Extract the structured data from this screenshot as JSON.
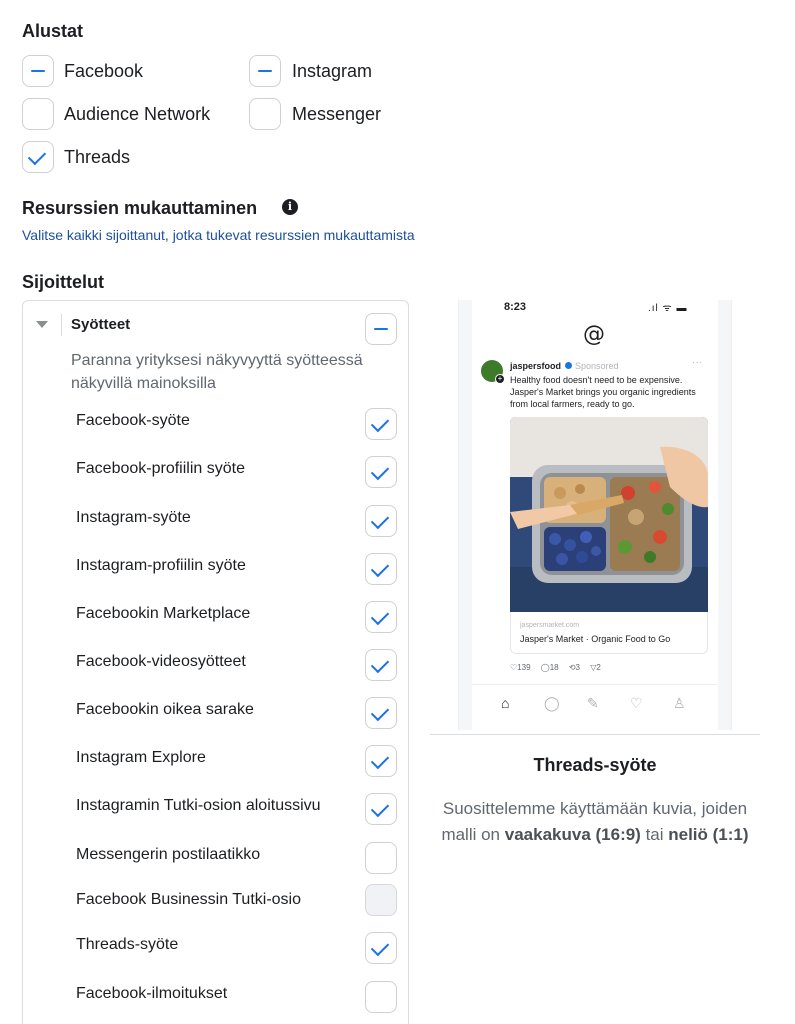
{
  "platforms": {
    "heading": "Alustat",
    "items": [
      {
        "label": "Facebook",
        "state": "partial"
      },
      {
        "label": "Instagram",
        "state": "partial"
      },
      {
        "label": "Audience Network",
        "state": "unchecked"
      },
      {
        "label": "Messenger",
        "state": "unchecked"
      },
      {
        "label": "Threads",
        "state": "checked"
      }
    ]
  },
  "customization": {
    "heading": "Resurssien mukauttaminen",
    "info_icon_glyph": "i",
    "link": "Valitse kaikki sijoittanut, jotka tukevat resurssien mukauttamista"
  },
  "placements": {
    "heading": "Sijoittelut",
    "group": {
      "title": "Syötteet",
      "state": "partial",
      "description": "Paranna yrityksesi näkyvyyttä syötteessä näkyvillä mainoksilla",
      "rows": [
        {
          "label": "Facebook-syöte",
          "state": "checked"
        },
        {
          "label": "Facebook-profiilin syöte",
          "state": "checked"
        },
        {
          "label": "Instagram-syöte",
          "state": "checked"
        },
        {
          "label": "Instagram-profiilin syöte",
          "state": "checked"
        },
        {
          "label": "Facebookin Marketplace",
          "state": "checked"
        },
        {
          "label": "Facebook-videosyötteet",
          "state": "checked"
        },
        {
          "label": "Facebookin oikea sarake",
          "state": "checked"
        },
        {
          "label": "Instagram Explore",
          "state": "checked"
        },
        {
          "label": "Instagramin Tutki-osion aloitussivu",
          "state": "checked"
        },
        {
          "label": "Messengerin postilaatikko",
          "state": "unchecked"
        },
        {
          "label": "Facebook Businessin Tutki-osio",
          "state": "disabled"
        },
        {
          "label": "Threads-syöte",
          "state": "checked"
        },
        {
          "label": "Facebook-ilmoitukset",
          "state": "unchecked"
        }
      ]
    }
  },
  "preview": {
    "phone": {
      "time": "8:23",
      "status_glyphs": ".ıl ᯤ ▬",
      "logo_glyph": "@",
      "username": "jaspersfood",
      "sponsored": "Sponsored",
      "more_glyph": "···",
      "post_text": "Healthy food doesn't need to be expensive. Jasper's Market brings you organic ingredients from local farmers, ready to go.",
      "link_domain": "jaspersmarket.com",
      "link_title": "Jasper's Market · Organic Food to Go",
      "stats": "♡139 ◯18 ⟲3 ▽2",
      "nav_icons": [
        "home-icon",
        "search-icon",
        "compose-icon",
        "heart-icon",
        "profile-icon"
      ]
    },
    "title": "Threads-syöte",
    "description_before": "Suosittelemme käyttämään kuvia, joiden malli on ",
    "bold_1": "vaakakuva (16:9)",
    "description_mid": " tai ",
    "bold_2": "neliö (1:1)"
  },
  "colors": {
    "accent": "#1b74e4",
    "link": "#1d4e9b",
    "text": "#1c1e21",
    "muted": "#606770"
  }
}
